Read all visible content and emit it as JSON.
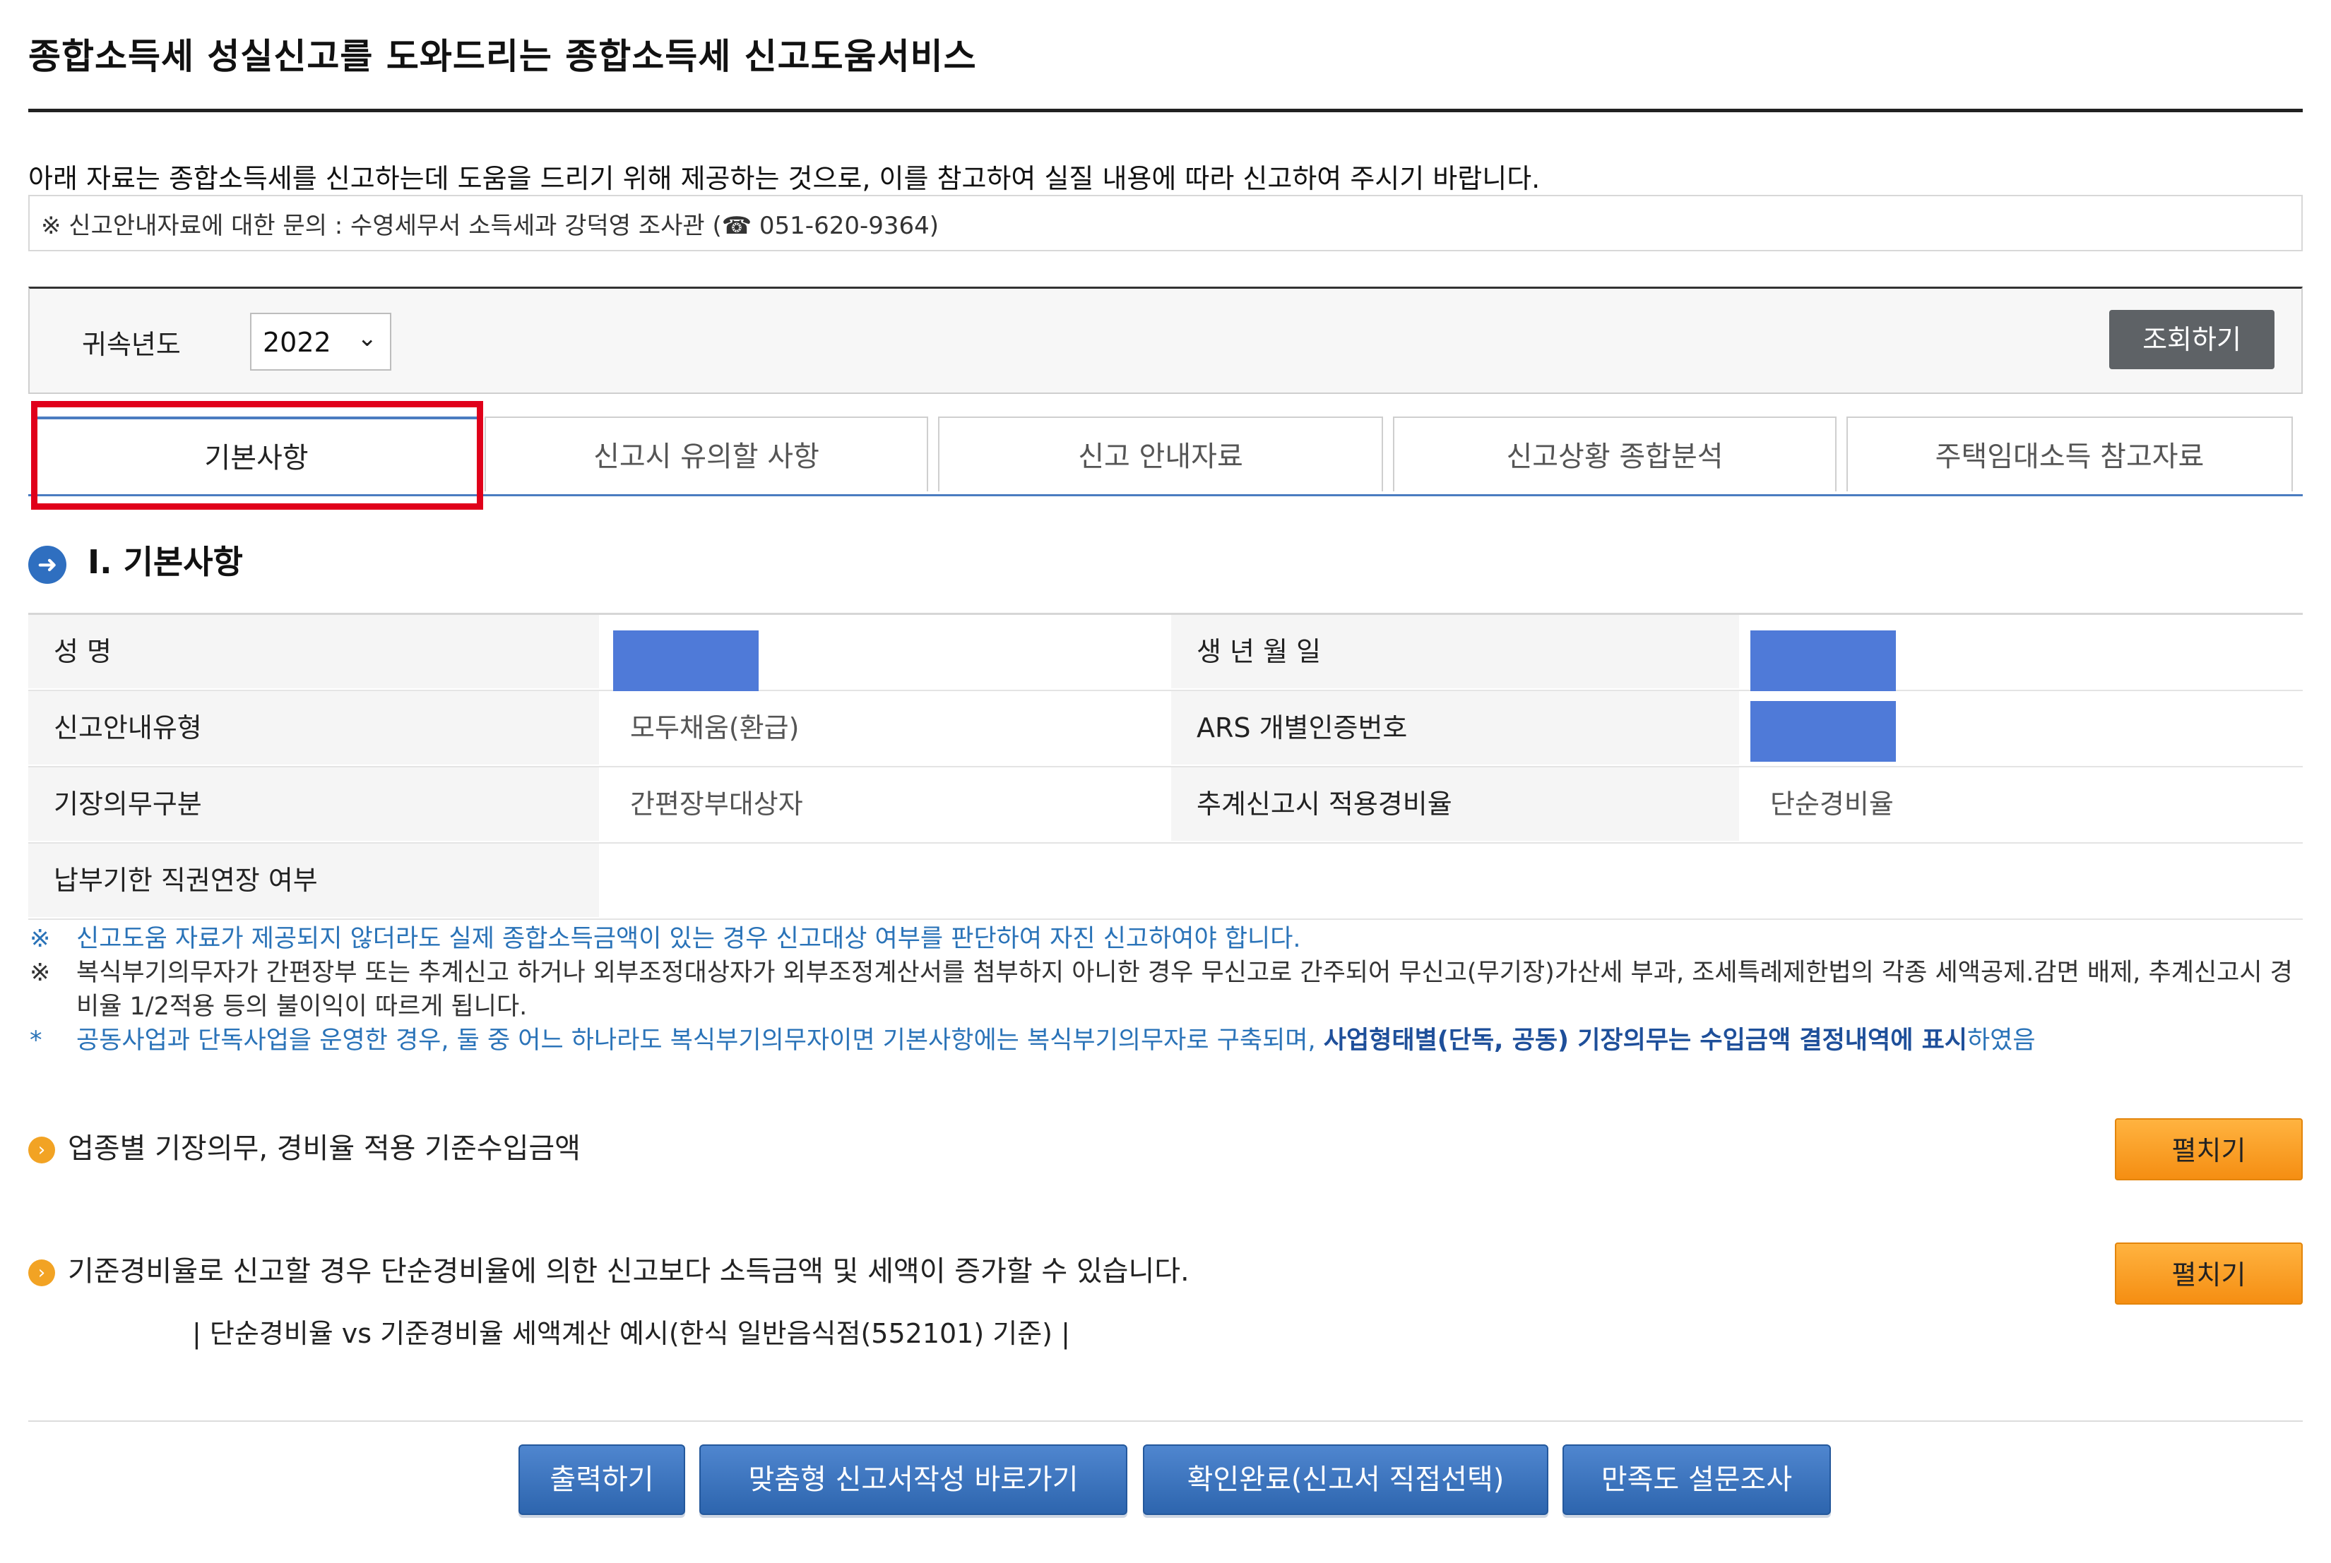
{
  "page": {
    "title": "종합소득세 성실신고를 도와드리는 종합소득세 신고도움서비스",
    "intro": "아래 자료는 종합소득세를 신고하는데 도움을 드리기 위해 제공하는 것으로, 이를 참고하여 실질 내용에 따라 신고하여 주시기 바랍니다.",
    "inquiry": "※ 신고안내자료에 대한 문의 : 수영세무서 소득세과 강덕영 조사관 (☎ 051-620-9364)"
  },
  "search": {
    "year_label": "귀속년도",
    "year_value": "2022",
    "button": "조회하기"
  },
  "tabs": [
    {
      "label": "기본사항",
      "active": true
    },
    {
      "label": "신고시 유의할 사항"
    },
    {
      "label": "신고 안내자료"
    },
    {
      "label": "신고상황 종합분석"
    },
    {
      "label": "주택임대소득 참고자료"
    }
  ],
  "section": {
    "heading": "Ⅰ. 기본사항"
  },
  "basic_info": {
    "name_label": "성          명",
    "birth_label": "생  년  월  일",
    "guide_type_label": "신고안내유형",
    "guide_type_value": "모두채움(환급)",
    "ars_label": "ARS 개별인증번호",
    "bookkeeping_label": "기장의무구분",
    "bookkeeping_value": "간편장부대상자",
    "estimate_rate_label": "추계신고시 적용경비율",
    "estimate_rate_value": "단순경비율",
    "deadline_label": "납부기한 직권연장 여부",
    "deadline_value": ""
  },
  "notes": {
    "note1_mark": "※",
    "note1": "신고도움 자료가 제공되지 않더라도 실제 종합소득금액이 있는 경우 신고대상 여부를 판단하여 자진 신고하여야 합니다.",
    "note2_mark": "※",
    "note2": "복식부기의무자가 간편장부 또는 추계신고 하거나 외부조정대상자가 외부조정계산서를 첨부하지 아니한 경우 무신고로 간주되어 무신고(무기장)가산세 부과, 조세특례제한법의 각종 세액공제.감면 배제, 추계신고시 경비율 1/2적용 등의 불이익이 따르게 됩니다.",
    "note3_mark": "*",
    "note3_a": "공동사업과 단독사업을 운영한 경우, 둘 중 어느 하나라도 복식부기의무자이면 기본사항에는 복식부기의무자로 구축되며, ",
    "note3_b": "사업형태별(단독, 공동) 기장의무는 수입금액 결정내역에 표시",
    "note3_c": "하였음"
  },
  "expand": {
    "row1": "업종별 기장의무, 경비율 적용 기준수입금액",
    "row2": "기준경비율로 신고할 경우 단순경비율에 의한 신고보다 소득금액 및 세액이 증가할 수 있습니다.",
    "button": "펼치기",
    "example": "| 단순경비율 vs 기준경비율 세액계산 예시(한식 일반음식점(552101) 기준) |"
  },
  "actions": {
    "print": "출력하기",
    "custom_form": "맞춤형 신고서작성 바로가기",
    "confirm": "확인완료(신고서 직접선택)",
    "survey": "만족도 설문조사"
  },
  "colors": {
    "accent_blue": "#4a7cc0",
    "highlight_red": "#e0001a",
    "mask_blue": "#4f7ad8",
    "expand_orange": "#f58e12",
    "action_blue": "#2d65ae"
  }
}
